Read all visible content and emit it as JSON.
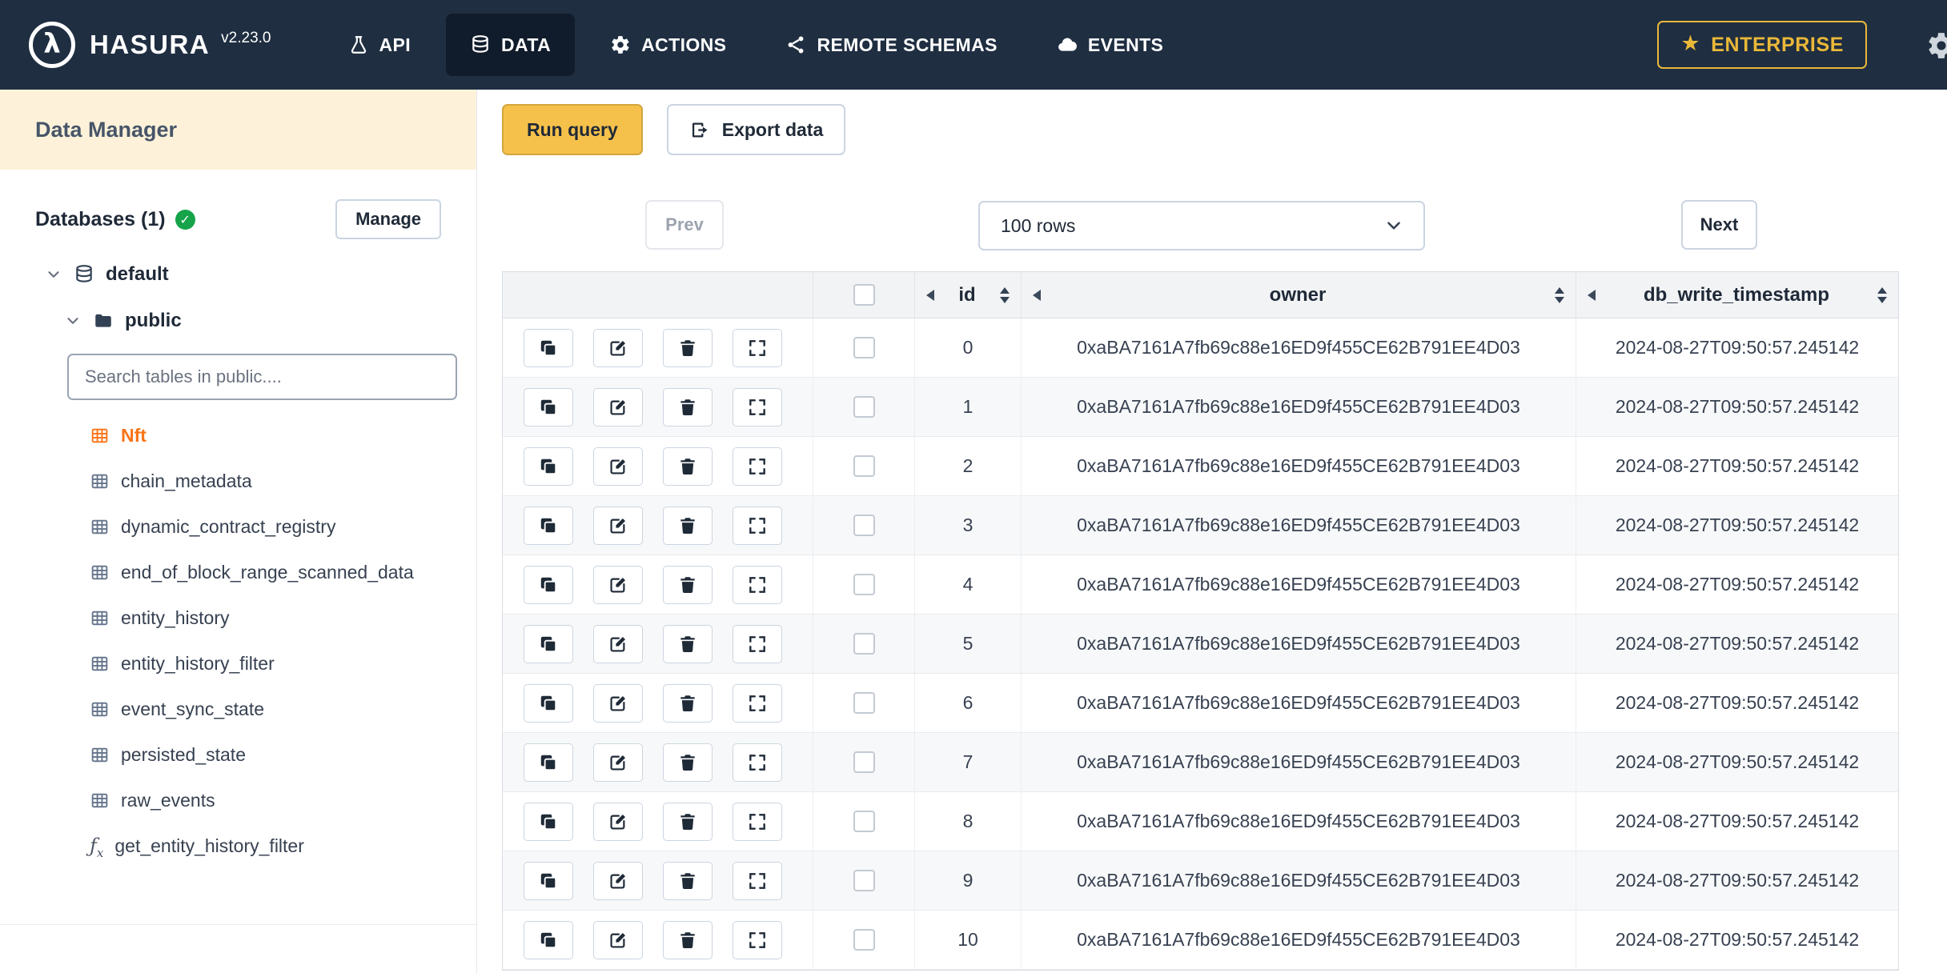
{
  "navbar": {
    "brand": "HASURA",
    "version": "v2.23.0",
    "items": [
      {
        "label": "API",
        "icon": "flask",
        "active": false
      },
      {
        "label": "DATA",
        "icon": "database",
        "active": true
      },
      {
        "label": "ACTIONS",
        "icon": "gears",
        "active": false
      },
      {
        "label": "REMOTE SCHEMAS",
        "icon": "share",
        "active": false
      },
      {
        "label": "EVENTS",
        "icon": "cloud",
        "active": false
      }
    ],
    "enterprise_label": "ENTERPRISE"
  },
  "sidebar": {
    "title": "Data Manager",
    "databases_label": "Databases (1)",
    "manage_label": "Manage",
    "database_name": "default",
    "schema_name": "public",
    "search_placeholder": "Search tables in public....",
    "tables": [
      {
        "name": "Nft",
        "kind": "table",
        "active": true
      },
      {
        "name": "chain_metadata",
        "kind": "table",
        "active": false
      },
      {
        "name": "dynamic_contract_registry",
        "kind": "table",
        "active": false
      },
      {
        "name": "end_of_block_range_scanned_data",
        "kind": "table",
        "active": false
      },
      {
        "name": "entity_history",
        "kind": "table",
        "active": false
      },
      {
        "name": "entity_history_filter",
        "kind": "table",
        "active": false
      },
      {
        "name": "event_sync_state",
        "kind": "table",
        "active": false
      },
      {
        "name": "persisted_state",
        "kind": "table",
        "active": false
      },
      {
        "name": "raw_events",
        "kind": "table",
        "active": false
      },
      {
        "name": "get_entity_history_filter",
        "kind": "function",
        "active": false
      }
    ]
  },
  "toolbar": {
    "run_query_label": "Run query",
    "export_data_label": "Export data"
  },
  "pagination": {
    "prev_label": "Prev",
    "rows_selected": "100 rows",
    "next_label": "Next"
  },
  "table": {
    "columns": [
      "id",
      "owner",
      "db_write_timestamp"
    ],
    "rows": [
      {
        "id": "0",
        "owner": "0xaBA7161A7fb69c88e16ED9f455CE62B791EE4D03",
        "db_write_timestamp": "2024-08-27T09:50:57.245142"
      },
      {
        "id": "1",
        "owner": "0xaBA7161A7fb69c88e16ED9f455CE62B791EE4D03",
        "db_write_timestamp": "2024-08-27T09:50:57.245142"
      },
      {
        "id": "2",
        "owner": "0xaBA7161A7fb69c88e16ED9f455CE62B791EE4D03",
        "db_write_timestamp": "2024-08-27T09:50:57.245142"
      },
      {
        "id": "3",
        "owner": "0xaBA7161A7fb69c88e16ED9f455CE62B791EE4D03",
        "db_write_timestamp": "2024-08-27T09:50:57.245142"
      },
      {
        "id": "4",
        "owner": "0xaBA7161A7fb69c88e16ED9f455CE62B791EE4D03",
        "db_write_timestamp": "2024-08-27T09:50:57.245142"
      },
      {
        "id": "5",
        "owner": "0xaBA7161A7fb69c88e16ED9f455CE62B791EE4D03",
        "db_write_timestamp": "2024-08-27T09:50:57.245142"
      },
      {
        "id": "6",
        "owner": "0xaBA7161A7fb69c88e16ED9f455CE62B791EE4D03",
        "db_write_timestamp": "2024-08-27T09:50:57.245142"
      },
      {
        "id": "7",
        "owner": "0xaBA7161A7fb69c88e16ED9f455CE62B791EE4D03",
        "db_write_timestamp": "2024-08-27T09:50:57.245142"
      },
      {
        "id": "8",
        "owner": "0xaBA7161A7fb69c88e16ED9f455CE62B791EE4D03",
        "db_write_timestamp": "2024-08-27T09:50:57.245142"
      },
      {
        "id": "9",
        "owner": "0xaBA7161A7fb69c88e16ED9f455CE62B791EE4D03",
        "db_write_timestamp": "2024-08-27T09:50:57.245142"
      },
      {
        "id": "10",
        "owner": "0xaBA7161A7fb69c88e16ED9f455CE62B791EE4D03",
        "db_write_timestamp": "2024-08-27T09:50:57.245142"
      }
    ]
  },
  "colors": {
    "navbar_bg": "#1f2e41",
    "navbar_active_bg": "#101c2b",
    "enterprise_gold": "#eab839",
    "run_query_yellow": "#f6c14b",
    "active_table_orange": "#f97316",
    "db_check_green": "#16a34a",
    "sidebar_header_cream": "#fdf2d9"
  }
}
